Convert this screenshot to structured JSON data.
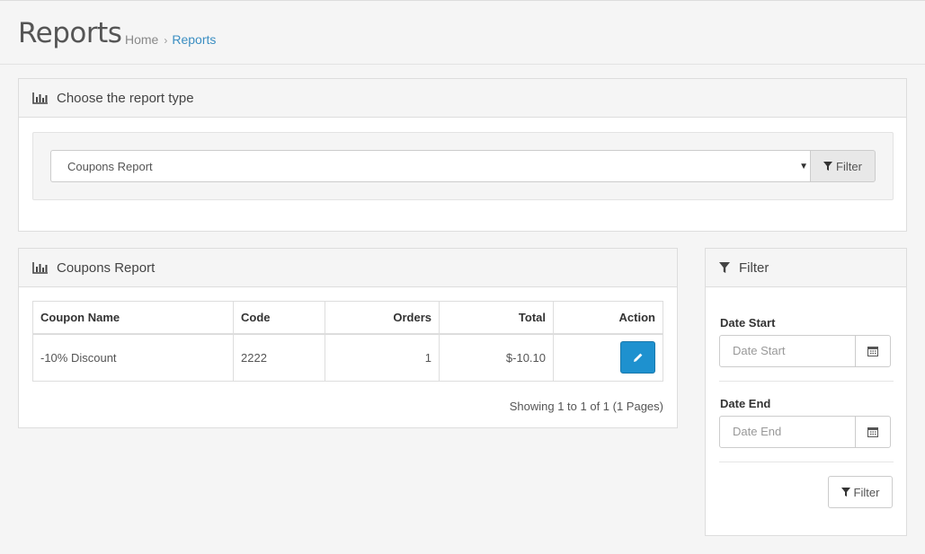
{
  "header": {
    "title": "Reports",
    "breadcrumb": {
      "home": "Home",
      "separator": "›",
      "current": "Reports"
    }
  },
  "report_type_panel": {
    "heading": "Choose the report type",
    "icon": "bar-chart-icon",
    "select_value": "Coupons Report",
    "filter_button": "Filter"
  },
  "report_panel": {
    "heading": "Coupons Report",
    "icon": "bar-chart-icon",
    "columns": [
      "Coupon Name",
      "Code",
      "Orders",
      "Total",
      "Action"
    ],
    "rows": [
      {
        "name": "-10% Discount",
        "code": "2222",
        "orders": "1",
        "total": "$-10.10",
        "action_icon": "pencil-icon"
      }
    ],
    "pagination": "Showing 1 to 1 of 1 (1 Pages)"
  },
  "filter_panel": {
    "heading": "Filter",
    "icon": "funnel-icon",
    "date_start_label": "Date Start",
    "date_start_placeholder": "Date Start",
    "date_end_label": "Date End",
    "date_end_placeholder": "Date End",
    "filter_button": "Filter"
  },
  "colors": {
    "accent": "#1e91cf",
    "link": "#3b8ec2",
    "background": "#f5f5f5"
  }
}
